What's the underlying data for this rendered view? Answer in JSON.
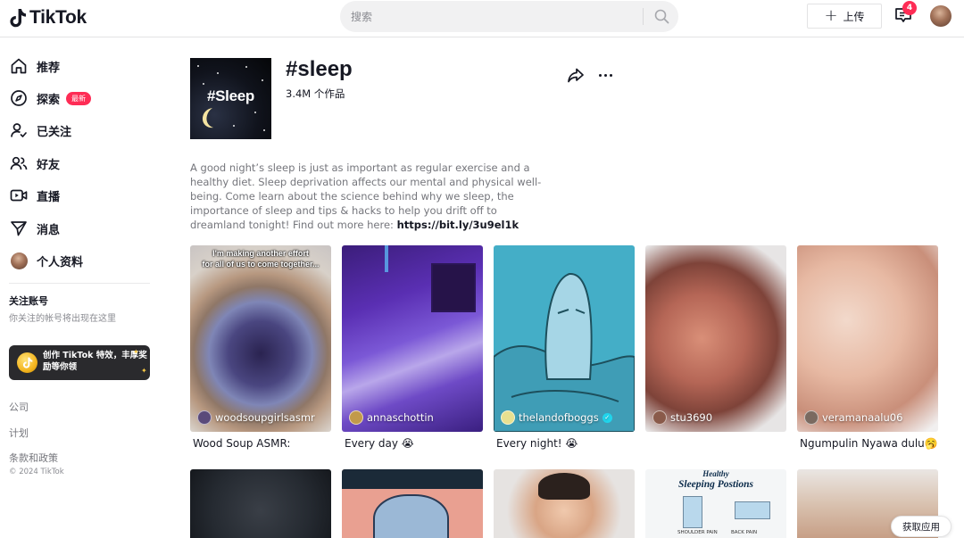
{
  "header": {
    "logo_text": "TikTok",
    "search_placeholder": "搜索",
    "upload_label": "上传",
    "inbox_count": "4"
  },
  "sidebar": {
    "items": [
      {
        "label": "推荐",
        "icon": "home-icon"
      },
      {
        "label": "探索",
        "icon": "compass-icon",
        "badge": "最新"
      },
      {
        "label": "已关注",
        "icon": "following-icon"
      },
      {
        "label": "好友",
        "icon": "friends-icon"
      },
      {
        "label": "直播",
        "icon": "live-icon"
      },
      {
        "label": "消息",
        "icon": "messages-icon"
      },
      {
        "label": "个人资料",
        "icon": "avatar"
      }
    ],
    "following_title": "关注账号",
    "following_subtitle": "你关注的帐号将出现在这里",
    "promo_text": "创作 TikTok 特效，丰厚奖励等你领",
    "footer_links": [
      "公司",
      "计划",
      "条款和政策"
    ],
    "copyright": "© 2024 TikTok"
  },
  "hashtag": {
    "cover_text": "#Sleep",
    "title": "#sleep",
    "count": "3.4M 个作品",
    "description": "A good night’s sleep is just as important as regular exercise and a healthy diet. Sleep deprivation affects our mental and physical well-being. Come learn about the science behind why we sleep, the importance of sleep and tips & hacks to help you drift off to dreamland tonight! Find out more here: ",
    "link": "https://bit.ly/3u9el1k"
  },
  "videos": [
    {
      "username": "woodsoupgirlsasmr",
      "caption": "Wood Soup ASMR:",
      "overlay_line1": "I'm making another effort",
      "overlay_line2": "for all of us to come together..."
    },
    {
      "username": "annaschottin",
      "caption": "Every day 😭"
    },
    {
      "username": "thelandofboggs",
      "caption": "Every night! 😭",
      "verified": true
    },
    {
      "username": "stu3690",
      "caption": ""
    },
    {
      "username": "veramanaalu06",
      "caption": "Ngumpulin Nyawa dulu🥱"
    }
  ],
  "second_row_overlay": {
    "line1": "Healthy",
    "line2": "Sleeping Postions",
    "label_a": "SHOULDER PAIN",
    "label_b": "BACK PAIN"
  },
  "get_app_label": "获取应用",
  "colors": {
    "accent": "#fe2c55",
    "verified": "#20d5ec",
    "promo_bg": "#2a2a2d"
  }
}
